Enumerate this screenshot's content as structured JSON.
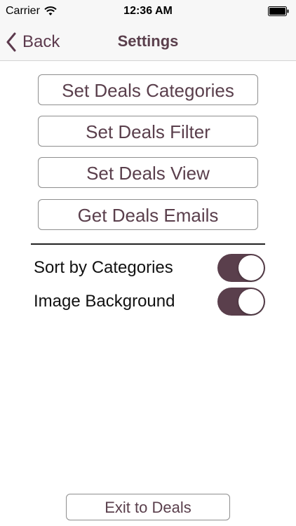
{
  "status_bar": {
    "carrier": "Carrier",
    "time": "12:36 AM"
  },
  "nav": {
    "back_label": "Back",
    "title": "Settings"
  },
  "menu_buttons": [
    "Set Deals Categories",
    "Set Deals Filter",
    "Set Deals View",
    "Get Deals Emails"
  ],
  "toggles": [
    {
      "label": "Sort by Categories",
      "on": true
    },
    {
      "label": "Image Background",
      "on": true
    }
  ],
  "footer": {
    "exit_label": "Exit to Deals"
  },
  "colors": {
    "accent": "#5a3f4c",
    "nav_background": "#f7f7f7"
  }
}
